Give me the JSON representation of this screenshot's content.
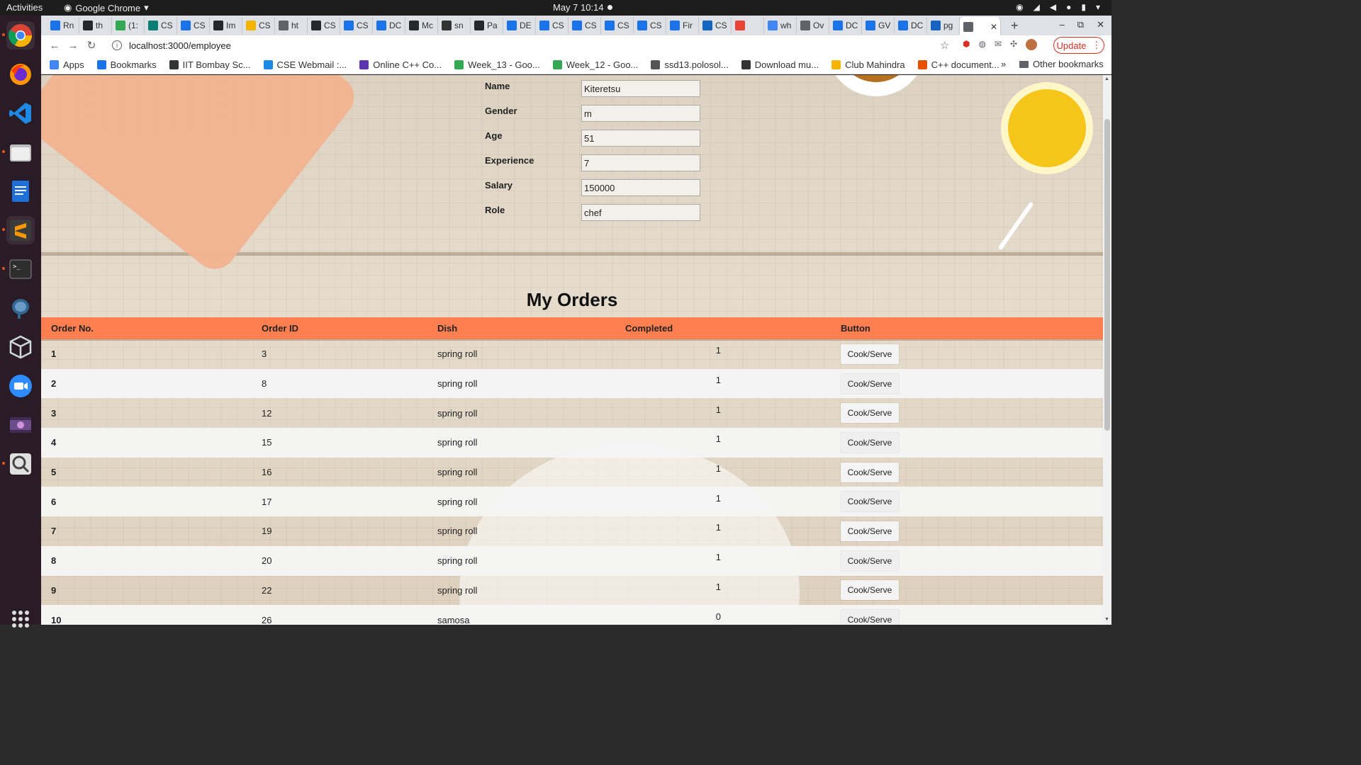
{
  "system": {
    "activities": "Activities",
    "app_name": "Google Chrome",
    "clock": "May 7  10:14"
  },
  "browser": {
    "tabs": [
      "Rn",
      "th",
      "(1:",
      "CS",
      "CS",
      "Im",
      "CS",
      "ht",
      "CS",
      "CS",
      "DC",
      "Mc",
      "sn",
      "Pa",
      "DE",
      "CS",
      "CS",
      "CS",
      "CS",
      "Fir",
      "CS",
      "",
      "wh",
      "Ov",
      "DC",
      "GV",
      "DC",
      "pg",
      ""
    ],
    "tab_colors": [
      "#1a73e8",
      "#24292e",
      "#34a853",
      "#0a7d75",
      "#1a73e8",
      "#24292e",
      "#f4b400",
      "#5f6368",
      "#24292e",
      "#1a73e8",
      "#1a73e8",
      "#24292e",
      "#333333",
      "#24292e",
      "#1a73e8",
      "#1a73e8",
      "#1a73e8",
      "#1a73e8",
      "#1a73e8",
      "#1a73e8",
      "#1565c0",
      "#ea4335",
      "#4285f4",
      "#5f6368",
      "#1a73e8",
      "#1a73e8",
      "#1a73e8",
      "#1565c0",
      "#5f6368"
    ],
    "url": "localhost:3000/employee",
    "update_label": "Update",
    "bookmarks": [
      {
        "label": "Apps",
        "color": "#4285f4"
      },
      {
        "label": "Bookmarks",
        "color": "#1a73e8"
      },
      {
        "label": "IIT Bombay Sc...",
        "color": "#333333"
      },
      {
        "label": "CSE Webmail :...",
        "color": "#1e88e5"
      },
      {
        "label": "Online C++ Co...",
        "color": "#5e35b1"
      },
      {
        "label": "Week_13 - Goo...",
        "color": "#34a853"
      },
      {
        "label": "Week_12 - Goo...",
        "color": "#34a853"
      },
      {
        "label": "ssd13.polosol...",
        "color": "#555555"
      },
      {
        "label": "Download mu...",
        "color": "#333333"
      },
      {
        "label": "Club Mahindra",
        "color": "#f4b400"
      },
      {
        "label": "C++ document...",
        "color": "#e65100"
      }
    ],
    "bookmarks_more": "»",
    "other_bookmarks": "Other bookmarks"
  },
  "profile": {
    "fields": [
      {
        "label": "Name",
        "value": "Kiteretsu"
      },
      {
        "label": "Gender",
        "value": "m"
      },
      {
        "label": "Age",
        "value": "51"
      },
      {
        "label": "Experience",
        "value": "7"
      },
      {
        "label": "Salary",
        "value": "150000"
      },
      {
        "label": "Role",
        "value": "chef"
      }
    ]
  },
  "orders": {
    "title": "My Orders",
    "columns": [
      "Order No.",
      "Order ID",
      "Dish",
      "Completed",
      "Button"
    ],
    "button_label": "Cook/Serve",
    "rows": [
      {
        "no": "1",
        "id": "3",
        "dish": "spring roll",
        "completed": "1"
      },
      {
        "no": "2",
        "id": "8",
        "dish": "spring roll",
        "completed": "1"
      },
      {
        "no": "3",
        "id": "12",
        "dish": "spring roll",
        "completed": "1"
      },
      {
        "no": "4",
        "id": "15",
        "dish": "spring roll",
        "completed": "1"
      },
      {
        "no": "5",
        "id": "16",
        "dish": "spring roll",
        "completed": "1"
      },
      {
        "no": "6",
        "id": "17",
        "dish": "spring roll",
        "completed": "1"
      },
      {
        "no": "7",
        "id": "19",
        "dish": "spring roll",
        "completed": "1"
      },
      {
        "no": "8",
        "id": "20",
        "dish": "spring roll",
        "completed": "1"
      },
      {
        "no": "9",
        "id": "22",
        "dish": "spring roll",
        "completed": "1"
      },
      {
        "no": "10",
        "id": "26",
        "dish": "samosa",
        "completed": "0"
      }
    ]
  },
  "colors": {
    "table_header": "#ff7f50",
    "update_accent": "#d93025"
  }
}
